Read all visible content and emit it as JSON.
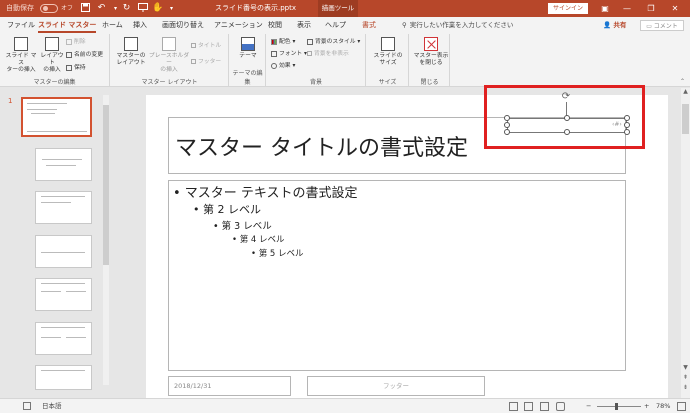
{
  "titlebar": {
    "autosave_label": "自動保存",
    "autosave_state": "オフ",
    "doc_title": "スライド番号の表示.pptx",
    "context_tool": "描画ツール",
    "signin_label": "サインイン",
    "colors": {
      "brand": "#b7472a",
      "accent": "#d35230"
    }
  },
  "tabs": [
    {
      "label": "ファイル"
    },
    {
      "label": "スライド マスター"
    },
    {
      "label": "ホーム"
    },
    {
      "label": "挿入"
    },
    {
      "label": "画面切り替え"
    },
    {
      "label": "アニメーション"
    },
    {
      "label": "校閲"
    },
    {
      "label": "表示"
    },
    {
      "label": "ヘルプ"
    },
    {
      "label": "書式"
    }
  ],
  "tellme": "実行したい作業を入力してください",
  "share_label": "共有",
  "comment_label": "コメント",
  "ribbon": {
    "groups": {
      "master_edit": "マスターの編集",
      "master_layout": "マスター レイアウト",
      "theme_edit": "テーマの編集",
      "background": "背景",
      "size": "サイズ",
      "close": "閉じる"
    },
    "buttons": {
      "insert_slide_master": "スライド マス\nターの挿入",
      "insert_layout": "レイアウト\nの挿入",
      "delete": "削除",
      "rename": "名前の変更",
      "preserve": "保持",
      "master_layout": "マスターの\nレイアウト",
      "insert_placeholder": "プレースホルダー\nの挿入",
      "title_check": "タイトル",
      "footer_check": "フッター",
      "themes": "テーマ",
      "colors": "配色",
      "fonts": "フォント",
      "effects": "効果",
      "bg_styles": "背景のスタイル",
      "hide_bg": "背景を非表示",
      "slide_size": "スライドの\nサイズ",
      "close_master": "マスター表示\nを閉じる"
    }
  },
  "thumbs": {
    "first_number": "1"
  },
  "slide": {
    "title": "マスター タイトルの書式設定",
    "levels": [
      "• マスター テキストの書式設定",
      "• 第 2 レベル",
      "• 第 3 レベル",
      "• 第 4 レベル",
      "• 第 5 レベル"
    ],
    "date": "2018/12/31",
    "footer": "フッター",
    "slide_number": "‹#›"
  },
  "statusbar": {
    "language": "日本語",
    "zoom": "78%"
  }
}
